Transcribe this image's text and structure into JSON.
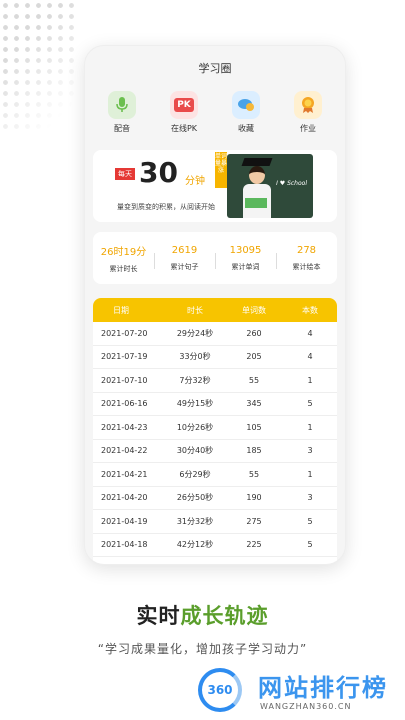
{
  "app": {
    "title": "学习圈"
  },
  "quick_actions": [
    {
      "label": "配音",
      "icon": "microphone-icon"
    },
    {
      "label": "在线PK",
      "icon": "pk-icon",
      "icon_text": "PK"
    },
    {
      "label": "收藏",
      "icon": "chat-bubble-icon"
    },
    {
      "label": "作业",
      "icon": "medal-icon"
    }
  ],
  "banner": {
    "badge": "每天",
    "number": "30",
    "unit": "分钟",
    "tag": "单词量暴涨",
    "slogan": "量变到质变的积累，从阅读开始",
    "board_text": "I ♥ School"
  },
  "stats": [
    {
      "value": "26时19分",
      "label": "累计时长"
    },
    {
      "value": "2619",
      "label": "累计句子"
    },
    {
      "value": "13095",
      "label": "累计单词"
    },
    {
      "value": "278",
      "label": "累计绘本"
    }
  ],
  "table": {
    "headers": [
      "日期",
      "时长",
      "单词数",
      "本数"
    ],
    "rows": [
      [
        "2021-07-20",
        "29分24秒",
        "260",
        "4"
      ],
      [
        "2021-07-19",
        "33分0秒",
        "205",
        "4"
      ],
      [
        "2021-07-10",
        "7分32秒",
        "55",
        "1"
      ],
      [
        "2021-06-16",
        "49分15秒",
        "345",
        "5"
      ],
      [
        "2021-04-23",
        "10分26秒",
        "105",
        "1"
      ],
      [
        "2021-04-22",
        "30分40秒",
        "185",
        "3"
      ],
      [
        "2021-04-21",
        "6分29秒",
        "55",
        "1"
      ],
      [
        "2021-04-20",
        "26分50秒",
        "190",
        "3"
      ],
      [
        "2021-04-19",
        "31分32秒",
        "275",
        "5"
      ],
      [
        "2021-04-18",
        "42分12秒",
        "225",
        "5"
      ]
    ]
  },
  "promo": {
    "headline_a": "实时",
    "headline_b": "成长轨迹",
    "subline": "“学习成果量化，增加孩子学习动力”"
  },
  "watermark": {
    "logo": "360",
    "name": "网站排行榜",
    "url": "WANGZHAN360.CN"
  },
  "colors": {
    "accent": "#f7c400",
    "highlight": "#f0a500",
    "green": "#5a9e2b"
  }
}
